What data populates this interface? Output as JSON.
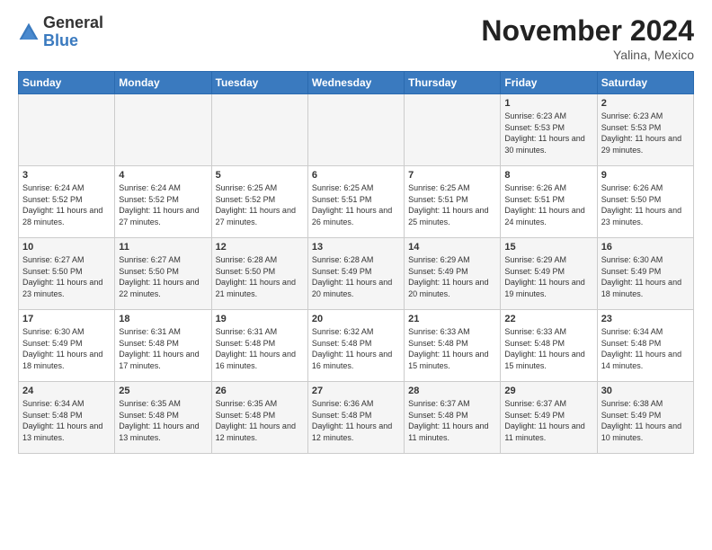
{
  "logo": {
    "general": "General",
    "blue": "Blue"
  },
  "title": "November 2024",
  "location": "Yalina, Mexico",
  "weekdays": [
    "Sunday",
    "Monday",
    "Tuesday",
    "Wednesday",
    "Thursday",
    "Friday",
    "Saturday"
  ],
  "weeks": [
    [
      {
        "day": "",
        "sunrise": "",
        "sunset": "",
        "daylight": ""
      },
      {
        "day": "",
        "sunrise": "",
        "sunset": "",
        "daylight": ""
      },
      {
        "day": "",
        "sunrise": "",
        "sunset": "",
        "daylight": ""
      },
      {
        "day": "",
        "sunrise": "",
        "sunset": "",
        "daylight": ""
      },
      {
        "day": "",
        "sunrise": "",
        "sunset": "",
        "daylight": ""
      },
      {
        "day": "1",
        "sunrise": "Sunrise: 6:23 AM",
        "sunset": "Sunset: 5:53 PM",
        "daylight": "Daylight: 11 hours and 30 minutes."
      },
      {
        "day": "2",
        "sunrise": "Sunrise: 6:23 AM",
        "sunset": "Sunset: 5:53 PM",
        "daylight": "Daylight: 11 hours and 29 minutes."
      }
    ],
    [
      {
        "day": "3",
        "sunrise": "Sunrise: 6:24 AM",
        "sunset": "Sunset: 5:52 PM",
        "daylight": "Daylight: 11 hours and 28 minutes."
      },
      {
        "day": "4",
        "sunrise": "Sunrise: 6:24 AM",
        "sunset": "Sunset: 5:52 PM",
        "daylight": "Daylight: 11 hours and 27 minutes."
      },
      {
        "day": "5",
        "sunrise": "Sunrise: 6:25 AM",
        "sunset": "Sunset: 5:52 PM",
        "daylight": "Daylight: 11 hours and 27 minutes."
      },
      {
        "day": "6",
        "sunrise": "Sunrise: 6:25 AM",
        "sunset": "Sunset: 5:51 PM",
        "daylight": "Daylight: 11 hours and 26 minutes."
      },
      {
        "day": "7",
        "sunrise": "Sunrise: 6:25 AM",
        "sunset": "Sunset: 5:51 PM",
        "daylight": "Daylight: 11 hours and 25 minutes."
      },
      {
        "day": "8",
        "sunrise": "Sunrise: 6:26 AM",
        "sunset": "Sunset: 5:51 PM",
        "daylight": "Daylight: 11 hours and 24 minutes."
      },
      {
        "day": "9",
        "sunrise": "Sunrise: 6:26 AM",
        "sunset": "Sunset: 5:50 PM",
        "daylight": "Daylight: 11 hours and 23 minutes."
      }
    ],
    [
      {
        "day": "10",
        "sunrise": "Sunrise: 6:27 AM",
        "sunset": "Sunset: 5:50 PM",
        "daylight": "Daylight: 11 hours and 23 minutes."
      },
      {
        "day": "11",
        "sunrise": "Sunrise: 6:27 AM",
        "sunset": "Sunset: 5:50 PM",
        "daylight": "Daylight: 11 hours and 22 minutes."
      },
      {
        "day": "12",
        "sunrise": "Sunrise: 6:28 AM",
        "sunset": "Sunset: 5:50 PM",
        "daylight": "Daylight: 11 hours and 21 minutes."
      },
      {
        "day": "13",
        "sunrise": "Sunrise: 6:28 AM",
        "sunset": "Sunset: 5:49 PM",
        "daylight": "Daylight: 11 hours and 20 minutes."
      },
      {
        "day": "14",
        "sunrise": "Sunrise: 6:29 AM",
        "sunset": "Sunset: 5:49 PM",
        "daylight": "Daylight: 11 hours and 20 minutes."
      },
      {
        "day": "15",
        "sunrise": "Sunrise: 6:29 AM",
        "sunset": "Sunset: 5:49 PM",
        "daylight": "Daylight: 11 hours and 19 minutes."
      },
      {
        "day": "16",
        "sunrise": "Sunrise: 6:30 AM",
        "sunset": "Sunset: 5:49 PM",
        "daylight": "Daylight: 11 hours and 18 minutes."
      }
    ],
    [
      {
        "day": "17",
        "sunrise": "Sunrise: 6:30 AM",
        "sunset": "Sunset: 5:49 PM",
        "daylight": "Daylight: 11 hours and 18 minutes."
      },
      {
        "day": "18",
        "sunrise": "Sunrise: 6:31 AM",
        "sunset": "Sunset: 5:48 PM",
        "daylight": "Daylight: 11 hours and 17 minutes."
      },
      {
        "day": "19",
        "sunrise": "Sunrise: 6:31 AM",
        "sunset": "Sunset: 5:48 PM",
        "daylight": "Daylight: 11 hours and 16 minutes."
      },
      {
        "day": "20",
        "sunrise": "Sunrise: 6:32 AM",
        "sunset": "Sunset: 5:48 PM",
        "daylight": "Daylight: 11 hours and 16 minutes."
      },
      {
        "day": "21",
        "sunrise": "Sunrise: 6:33 AM",
        "sunset": "Sunset: 5:48 PM",
        "daylight": "Daylight: 11 hours and 15 minutes."
      },
      {
        "day": "22",
        "sunrise": "Sunrise: 6:33 AM",
        "sunset": "Sunset: 5:48 PM",
        "daylight": "Daylight: 11 hours and 15 minutes."
      },
      {
        "day": "23",
        "sunrise": "Sunrise: 6:34 AM",
        "sunset": "Sunset: 5:48 PM",
        "daylight": "Daylight: 11 hours and 14 minutes."
      }
    ],
    [
      {
        "day": "24",
        "sunrise": "Sunrise: 6:34 AM",
        "sunset": "Sunset: 5:48 PM",
        "daylight": "Daylight: 11 hours and 13 minutes."
      },
      {
        "day": "25",
        "sunrise": "Sunrise: 6:35 AM",
        "sunset": "Sunset: 5:48 PM",
        "daylight": "Daylight: 11 hours and 13 minutes."
      },
      {
        "day": "26",
        "sunrise": "Sunrise: 6:35 AM",
        "sunset": "Sunset: 5:48 PM",
        "daylight": "Daylight: 11 hours and 12 minutes."
      },
      {
        "day": "27",
        "sunrise": "Sunrise: 6:36 AM",
        "sunset": "Sunset: 5:48 PM",
        "daylight": "Daylight: 11 hours and 12 minutes."
      },
      {
        "day": "28",
        "sunrise": "Sunrise: 6:37 AM",
        "sunset": "Sunset: 5:48 PM",
        "daylight": "Daylight: 11 hours and 11 minutes."
      },
      {
        "day": "29",
        "sunrise": "Sunrise: 6:37 AM",
        "sunset": "Sunset: 5:49 PM",
        "daylight": "Daylight: 11 hours and 11 minutes."
      },
      {
        "day": "30",
        "sunrise": "Sunrise: 6:38 AM",
        "sunset": "Sunset: 5:49 PM",
        "daylight": "Daylight: 11 hours and 10 minutes."
      }
    ]
  ]
}
